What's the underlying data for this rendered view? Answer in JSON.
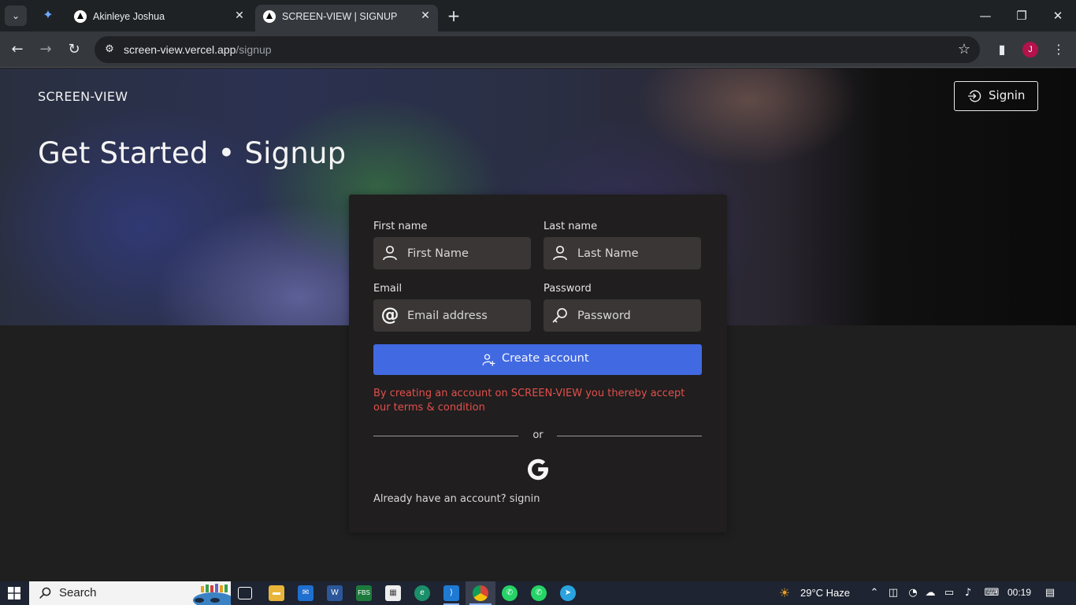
{
  "browser": {
    "tabs": [
      {
        "title": "Akinleye Joshua"
      },
      {
        "title": "SCREEN-VIEW | SIGNUP"
      }
    ],
    "url_host": "screen-view.vercel.app",
    "url_path": "/signup",
    "profile_initial": "J"
  },
  "page": {
    "brand": "SCREEN-VIEW",
    "signin_label": "Signin",
    "title": "Get Started • Signup"
  },
  "form": {
    "first_name_label": "First name",
    "first_name_placeholder": "First Name",
    "last_name_label": "Last name",
    "last_name_placeholder": "Last Name",
    "email_label": "Email",
    "email_placeholder": "Email address",
    "password_label": "Password",
    "password_placeholder": "Password",
    "create_label": "Create account",
    "terms_text": "By creating an account on SCREEN-VIEW you thereby accept our terms & condition",
    "or_text": "or",
    "already_text": "Already have an account? signin",
    "accent_color": "#4169e1",
    "terms_color": "#e0504e"
  },
  "taskbar": {
    "search_label": "Search",
    "weather": "29°C  Haze",
    "time": "00:19"
  }
}
